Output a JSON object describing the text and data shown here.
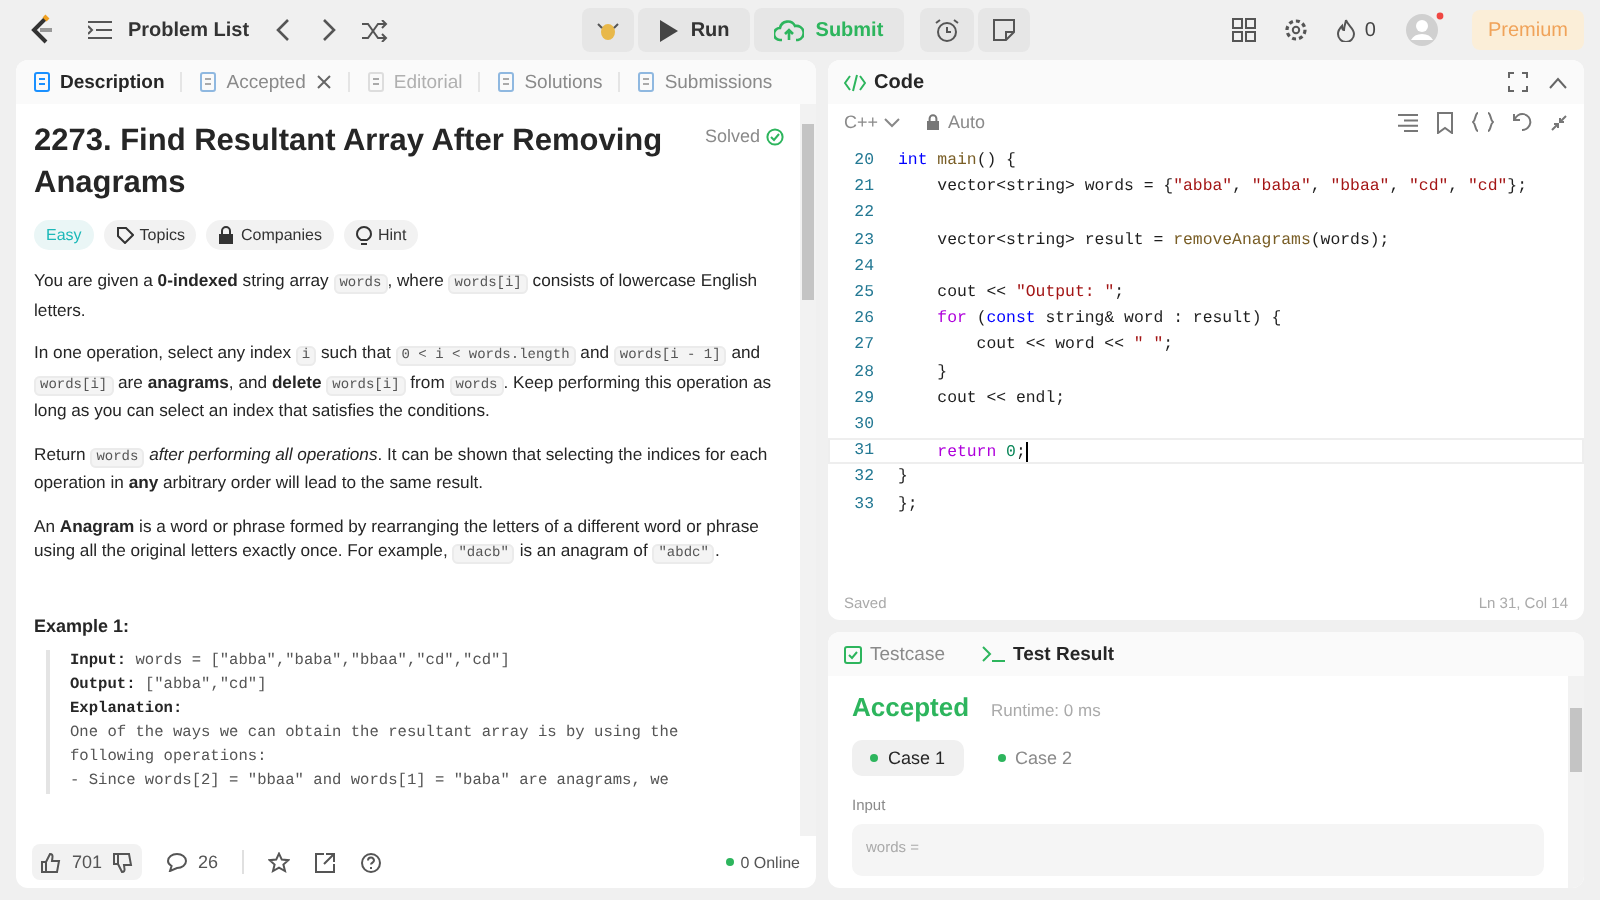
{
  "top_bar": {
    "problem_list": "Problem List",
    "run": "Run",
    "submit": "Submit",
    "streak": "0",
    "premium": "Premium"
  },
  "description_tabs": [
    {
      "label": "Description",
      "selected": true,
      "disabled": false,
      "closable": false
    },
    {
      "label": "Accepted",
      "selected": false,
      "disabled": false,
      "closable": true
    },
    {
      "label": "Editorial",
      "selected": false,
      "disabled": true,
      "closable": false
    },
    {
      "label": "Solutions",
      "selected": false,
      "disabled": false,
      "closable": false
    },
    {
      "label": "Submissions",
      "selected": false,
      "disabled": false,
      "closable": false
    }
  ],
  "problem": {
    "title": "2273. Find Resultant Array After Removing Anagrams",
    "status": "Solved",
    "difficulty": "Easy",
    "tags": [
      "Topics",
      "Companies",
      "Hint"
    ],
    "paragraphs": [
      [
        {
          "kind": "text",
          "text": "You are given a **0-indexed** string array "
        },
        {
          "kind": "code",
          "text": "words"
        },
        {
          "kind": "text",
          "text": ", where "
        },
        {
          "kind": "code",
          "text": "words[i]"
        },
        {
          "kind": "text",
          "text": " consists of lowercase English letters."
        }
      ],
      [
        {
          "kind": "text",
          "text": "In one operation, select any index "
        },
        {
          "kind": "code",
          "text": "i"
        },
        {
          "kind": "text",
          "text": " such that "
        },
        {
          "kind": "code",
          "text": "0 < i < words.length"
        },
        {
          "kind": "text",
          "text": " and "
        },
        {
          "kind": "code",
          "text": "words[i - 1]"
        },
        {
          "kind": "text",
          "text": " and "
        },
        {
          "kind": "code",
          "text": "words[i]"
        },
        {
          "kind": "text",
          "text": " are **anagrams**, and **delete** "
        },
        {
          "kind": "code",
          "text": "words[i]"
        },
        {
          "kind": "text",
          "text": " from "
        },
        {
          "kind": "code",
          "text": "words"
        },
        {
          "kind": "text",
          "text": ". Keep performing this operation as long as you can select an index that satisfies the conditions."
        }
      ],
      [
        {
          "kind": "text",
          "text": "Return "
        },
        {
          "kind": "code",
          "text": "words"
        },
        {
          "kind": "text",
          "text": " *after performing all operations*. It can be shown that selecting the indices for each operation in **any** arbitrary order will lead to the same result."
        }
      ],
      [
        {
          "kind": "text",
          "text": "An **Anagram** is a word or phrase formed by rearranging the letters of a different word or phrase using all the original letters exactly once. For example, "
        },
        {
          "kind": "code",
          "text": "\"dacb\""
        },
        {
          "kind": "text",
          "text": " is an anagram of "
        },
        {
          "kind": "code",
          "text": "\"abdc\""
        },
        {
          "kind": "text",
          "text": "."
        }
      ]
    ],
    "example": {
      "heading": "Example 1:",
      "lines": [
        "**Input:** words = [\"abba\",\"baba\",\"bbaa\",\"cd\",\"cd\"]",
        "**Output:** [\"abba\",\"cd\"]",
        "**Explanation:**",
        "One of the ways we can obtain the resultant array is by using the following operations:",
        "- Since words[2] = \"bbaa\" and words[1] = \"baba\" are anagrams, we"
      ]
    }
  },
  "footer": {
    "likes": "701",
    "comments": "26",
    "online": "0 Online"
  },
  "editor": {
    "title": "Code",
    "language": "C++",
    "mode": "Auto",
    "status": "Saved",
    "position": "Ln 31, Col 14",
    "lines": [
      {
        "number": "20",
        "current": false,
        "tokens": [
          {
            "kind": "type",
            "text": "int "
          },
          {
            "kind": "fn",
            "text": "main"
          },
          {
            "kind": "plain",
            "text": "() {"
          }
        ]
      },
      {
        "number": "21",
        "current": false,
        "tokens": [
          {
            "kind": "plain",
            "text": "    vector<string> words = {"
          },
          {
            "kind": "str",
            "text": "\"abba\""
          },
          {
            "kind": "plain",
            "text": ", "
          },
          {
            "kind": "str",
            "text": "\"baba\""
          },
          {
            "kind": "plain",
            "text": ", "
          },
          {
            "kind": "str",
            "text": "\"bbaa\""
          },
          {
            "kind": "plain",
            "text": ", "
          },
          {
            "kind": "str",
            "text": "\"cd\""
          },
          {
            "kind": "plain",
            "text": ", "
          },
          {
            "kind": "str",
            "text": "\"cd\""
          },
          {
            "kind": "plain",
            "text": "};"
          }
        ]
      },
      {
        "number": "22",
        "current": false
      },
      {
        "number": "23",
        "current": false,
        "tokens": [
          {
            "kind": "plain",
            "text": "    vector<string> result = "
          },
          {
            "kind": "fn",
            "text": "removeAnagrams"
          },
          {
            "kind": "plain",
            "text": "(words);"
          }
        ]
      },
      {
        "number": "24",
        "current": false
      },
      {
        "number": "25",
        "current": false,
        "tokens": [
          {
            "kind": "plain",
            "text": "    cout << "
          },
          {
            "kind": "str",
            "text": "\"Output: \""
          },
          {
            "kind": "plain",
            "text": ";"
          }
        ]
      },
      {
        "number": "26",
        "current": false,
        "tokens": [
          {
            "kind": "control",
            "text": "    for"
          },
          {
            "kind": "plain",
            "text": " ("
          },
          {
            "kind": "type",
            "text": "const"
          },
          {
            "kind": "plain",
            "text": " string& word : result) {"
          }
        ]
      },
      {
        "number": "27",
        "current": false,
        "tokens": [
          {
            "kind": "plain",
            "text": "        cout << word << "
          },
          {
            "kind": "str",
            "text": "\" \""
          },
          {
            "kind": "plain",
            "text": ";"
          }
        ]
      },
      {
        "number": "28",
        "current": false,
        "tokens": [
          {
            "kind": "plain",
            "text": "    }"
          }
        ]
      },
      {
        "number": "29",
        "current": false,
        "tokens": [
          {
            "kind": "plain",
            "text": "    cout << endl;"
          }
        ]
      },
      {
        "number": "30",
        "current": false
      },
      {
        "number": "31",
        "current": true,
        "tokens": [
          {
            "kind": "control",
            "text": "    return"
          },
          {
            "kind": "num",
            "text": " 0"
          },
          {
            "kind": "plain",
            "text": ";"
          }
        ]
      },
      {
        "number": "32",
        "current": false,
        "tokens": [
          {
            "kind": "plain",
            "text": "}"
          }
        ]
      },
      {
        "number": "33",
        "current": false,
        "tokens": [
          {
            "kind": "plain",
            "text": "};"
          }
        ]
      }
    ]
  },
  "console_tabs": [
    {
      "label": "Testcase",
      "selected": false
    },
    {
      "label": "Test Result",
      "selected": true
    }
  ],
  "result": {
    "verdict": "Accepted",
    "runtime": "Runtime: 0 ms",
    "cases": [
      {
        "label": "Case 1",
        "selected": true
      },
      {
        "label": "Case 2",
        "selected": false
      }
    ],
    "input_label": "Input",
    "variable": "words ="
  }
}
